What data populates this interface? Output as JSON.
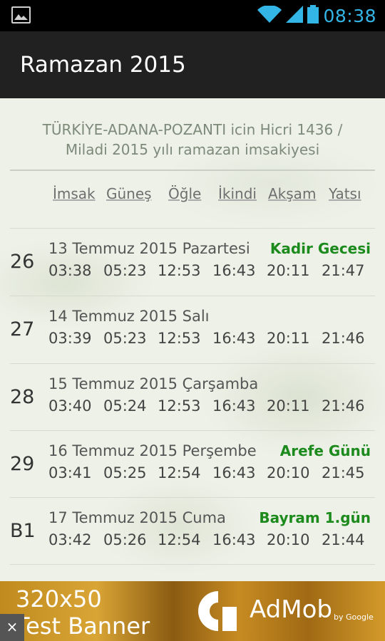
{
  "status_bar": {
    "time": "08:38",
    "icons": [
      "image-icon",
      "wifi-icon",
      "signal-icon",
      "battery-icon"
    ]
  },
  "action_bar": {
    "title": "Ramazan 2015"
  },
  "header": {
    "line1": "TÜRKİYE-ADANA-POZANTI icin Hicri 1436 /",
    "line2": "Miladi 2015 yılı ramazan imsakiyesi"
  },
  "columns": [
    "İmsak",
    "Güneş",
    "Öğle",
    "İkindi",
    "Akşam",
    "Yatsı"
  ],
  "days": [
    {
      "num": "26",
      "date": "13 Temmuz 2015 Pazartesi",
      "note": "Kadir Gecesi",
      "times": [
        "03:38",
        "05:23",
        "12:53",
        "16:43",
        "20:11",
        "21:47"
      ]
    },
    {
      "num": "27",
      "date": "14 Temmuz 2015 Salı",
      "note": "",
      "times": [
        "03:39",
        "05:23",
        "12:53",
        "16:43",
        "20:11",
        "21:46"
      ]
    },
    {
      "num": "28",
      "date": "15 Temmuz 2015 Çarşamba",
      "note": "",
      "times": [
        "03:40",
        "05:24",
        "12:53",
        "16:43",
        "20:11",
        "21:46"
      ]
    },
    {
      "num": "29",
      "date": "16 Temmuz 2015 Perşembe",
      "note": "Arefe Günü",
      "times": [
        "03:41",
        "05:25",
        "12:54",
        "16:43",
        "20:10",
        "21:45"
      ]
    },
    {
      "num": "B1",
      "date": "17 Temmuz 2015 Cuma",
      "note": "Bayram 1.gün",
      "times": [
        "03:42",
        "05:26",
        "12:54",
        "16:43",
        "20:10",
        "21:44"
      ]
    }
  ],
  "ad": {
    "size": "320x50",
    "label": "Test Banner",
    "brand": "AdMob",
    "by": "by Google",
    "close": "×"
  },
  "colors": {
    "accent": "#33b5e5",
    "note": "#1c8a1c",
    "action_bar": "#212121"
  }
}
